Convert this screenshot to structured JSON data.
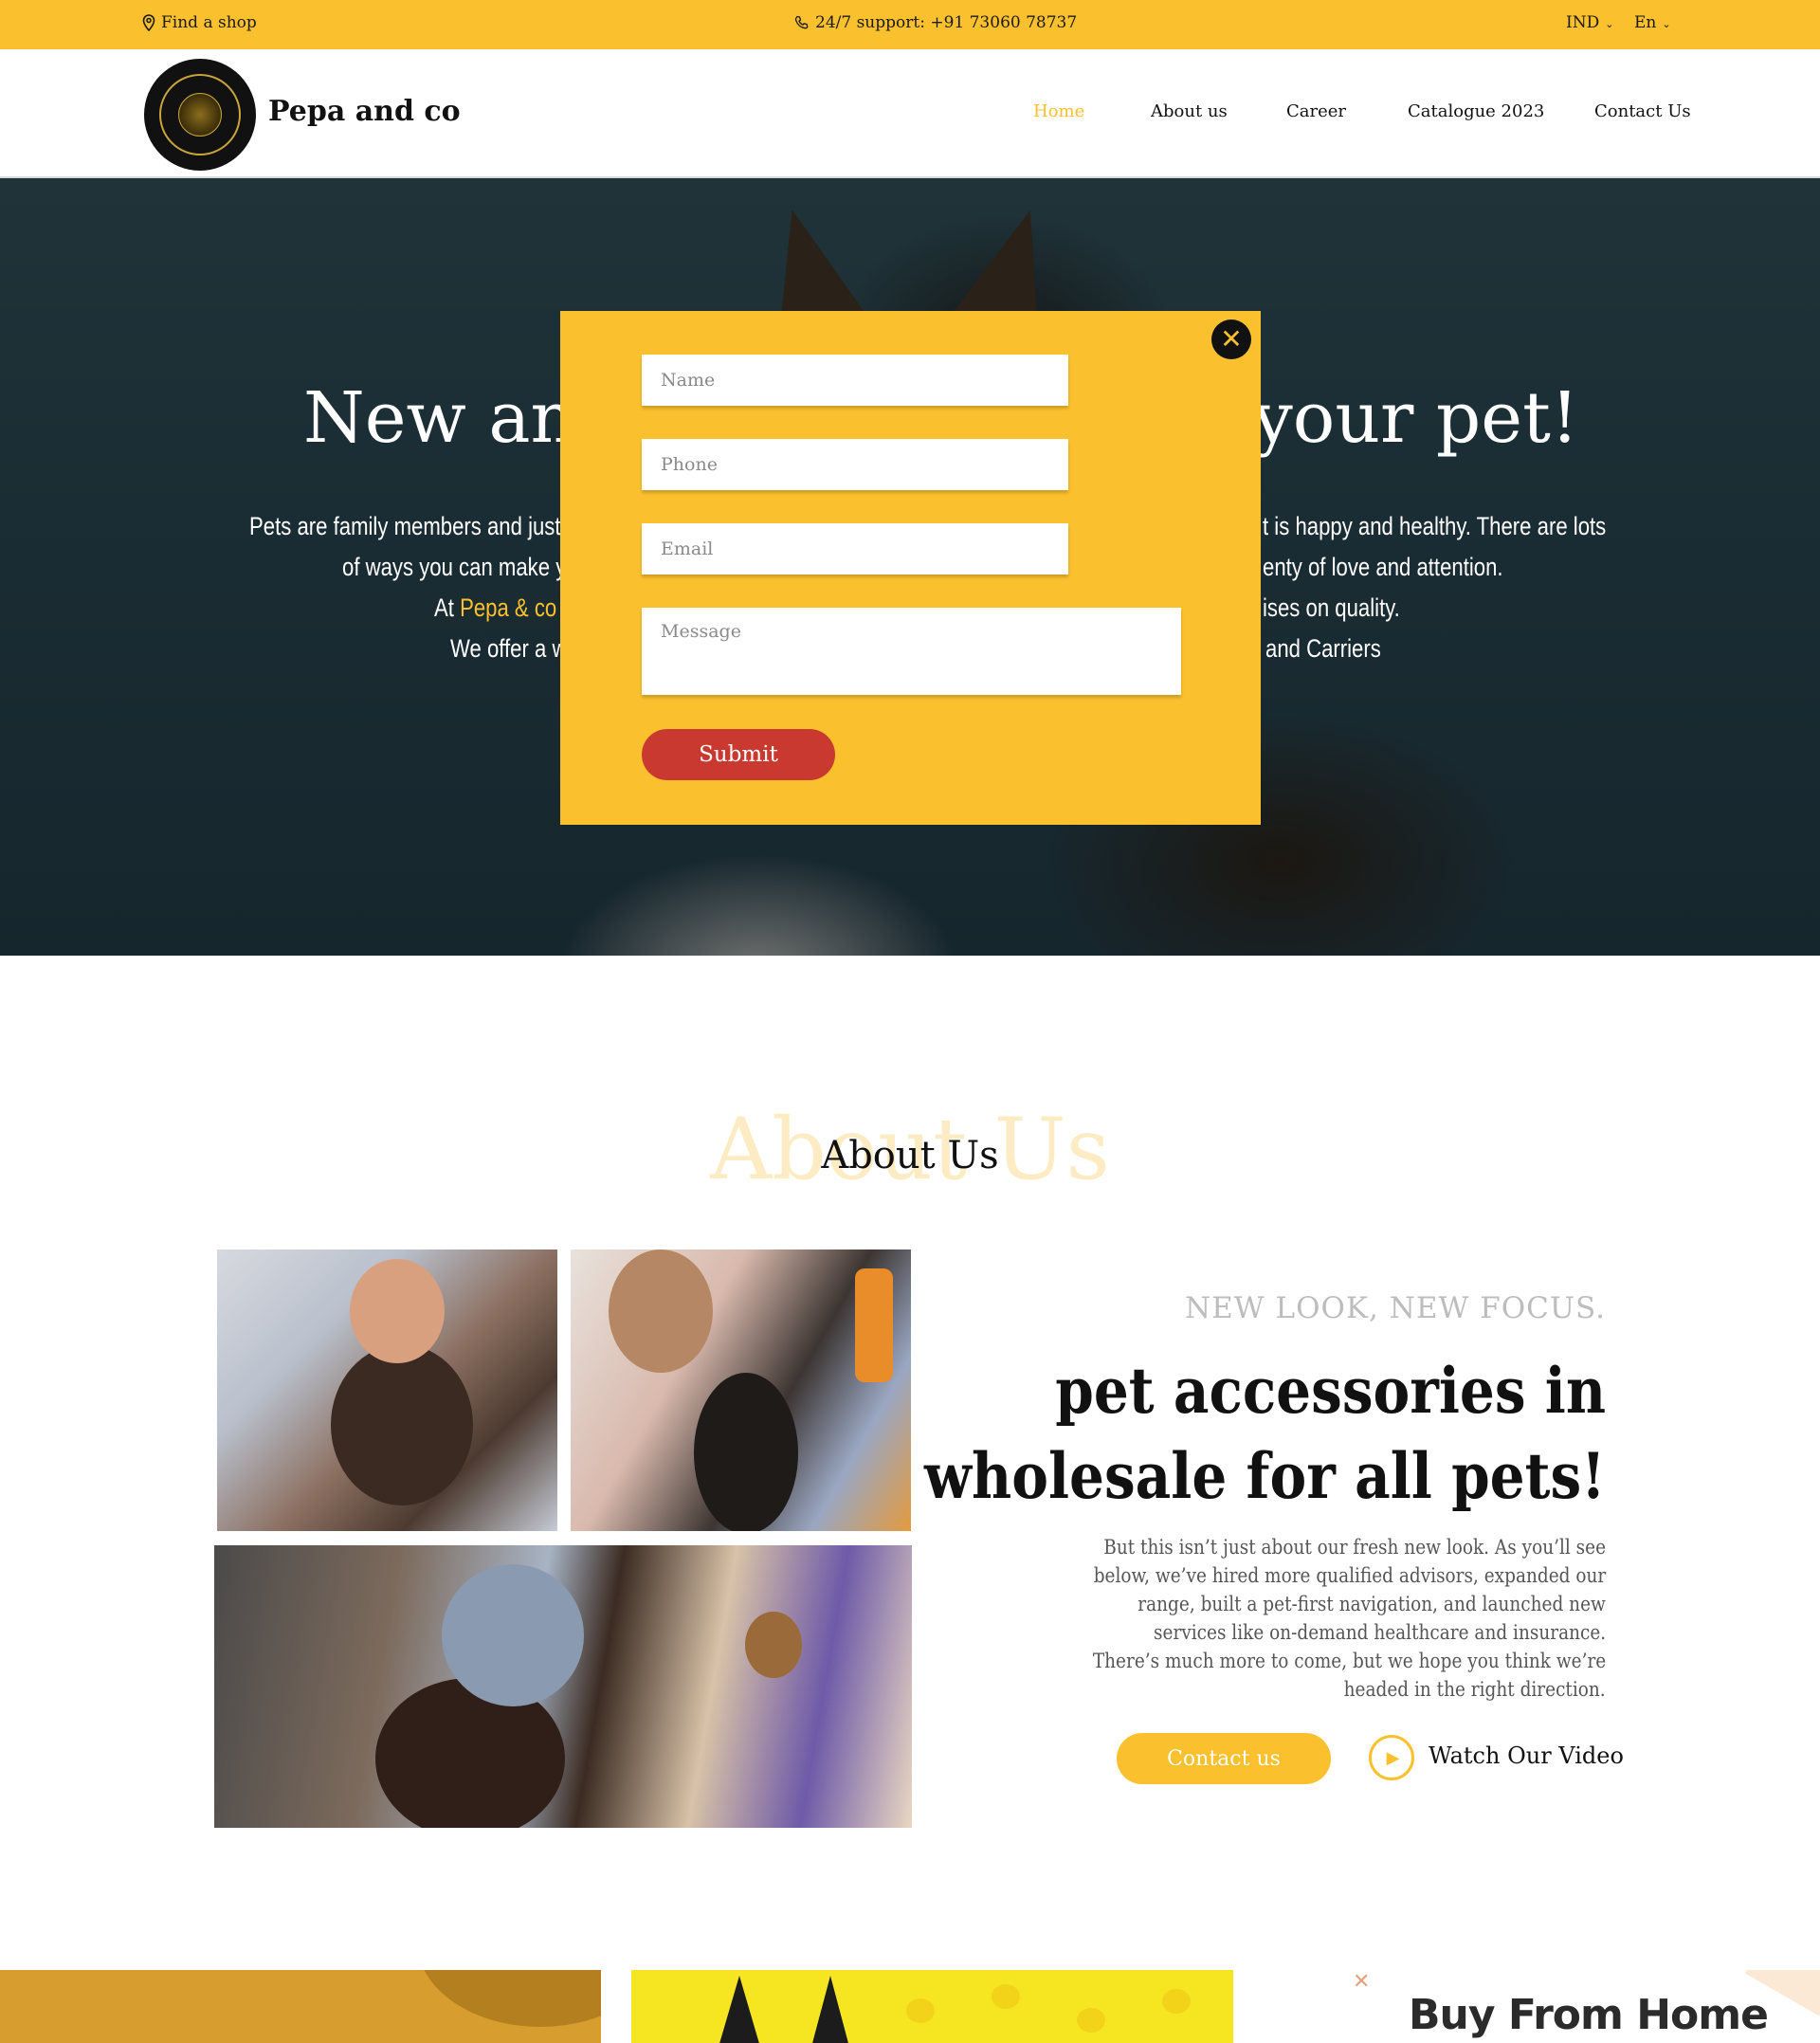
{
  "topbar": {
    "find_shop": "Find a shop",
    "support": "24/7 support: +91  73060 78737",
    "currency": "IND",
    "language": "En"
  },
  "header": {
    "brand": "Pepa and co",
    "nav": [
      "Home",
      "About us",
      "Career",
      "Catalogue 2023",
      "Contact Us"
    ],
    "active_nav": "Home"
  },
  "hero": {
    "title_left": "New and",
    "title_right": "your pet!",
    "lines": [
      {
        "left": "Pets are family members and just like",
        "right": "t is happy and healthy. There are lots"
      },
      {
        "left": "of ways you can make you",
        "right": "enty of love and attention."
      },
      {
        "left_prefix": "At ",
        "left_highlight": "Pepa & co",
        "left_suffix": " P",
        "right": "ises on quality."
      },
      {
        "left": "We offer a wi",
        "right": "and Carriers"
      }
    ]
  },
  "modal": {
    "name_placeholder": "Name",
    "phone_placeholder": "Phone",
    "email_placeholder": "Email",
    "message_placeholder": "Message",
    "submit_label": "Submit",
    "close_symbol": "✕"
  },
  "about": {
    "bg_title": "About Us",
    "title": "About Us",
    "eyebrow": "NEW LOOK, NEW FOCUS.",
    "headline_line1": "pet accessories in",
    "headline_line2": "wholesale for all pets!",
    "paragraph_lines": [
      "But this isn’t just about our fresh new look. As you’ll see",
      "below, we’ve hired more qualified advisors, expanded our",
      "range, built a pet-first navigation, and launched new",
      "services like on-demand healthcare and insurance.",
      "There’s much more to come, but we hope you think we’re",
      "headed in the right direction."
    ],
    "contact_button": "Contact us",
    "watch_label": "Watch Our Video"
  },
  "promo": {
    "buy_from_home": "Buy From Home"
  },
  "colors": {
    "accent": "#fbc02d",
    "submit": "#c9392f",
    "hero_bg": "#1f3339"
  },
  "icons": [
    "location-pin-icon",
    "phone-icon",
    "chevron-down-icon",
    "close-icon",
    "play-icon"
  ]
}
